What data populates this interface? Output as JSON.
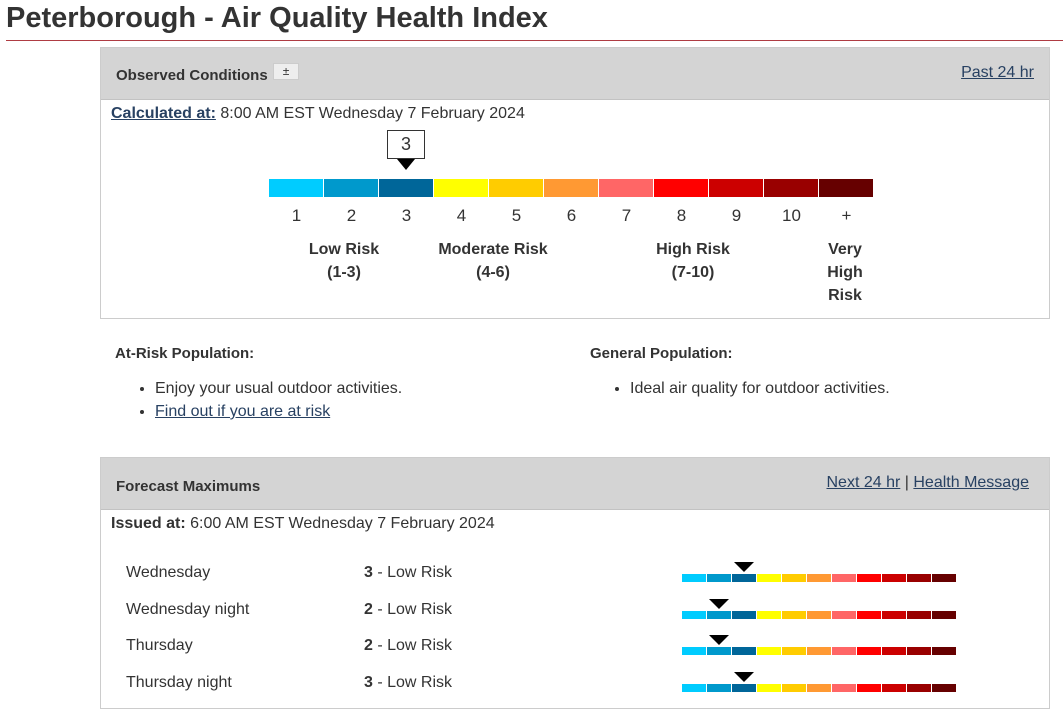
{
  "page": {
    "title": "Peterborough - Air Quality Health Index"
  },
  "observed": {
    "heading": "Observed Conditions",
    "toggle_symbol": "±",
    "past_link": "Past 24 hr",
    "calculated_label": "Calculated at:",
    "calculated_value": " 8:00 AM EST Wednesday 7 February 2024",
    "current_value": "3",
    "scale_labels": [
      "1",
      "2",
      "3",
      "4",
      "5",
      "6",
      "7",
      "8",
      "9",
      "10",
      "+"
    ],
    "scale_colors": [
      "#00ccff",
      "#0099cc",
      "#006699",
      "#ffff00",
      "#ffcc00",
      "#ff9933",
      "#ff6666",
      "#ff0000",
      "#cc0000",
      "#990000",
      "#660000"
    ],
    "risk_levels": [
      {
        "line1": "Low Risk",
        "line2": "(1-3)"
      },
      {
        "line1": "Moderate Risk",
        "line2": "(4-6)"
      },
      {
        "line1": "High Risk",
        "line2": "(7-10)"
      },
      {
        "line1": "Very",
        "line2": "High",
        "line3": "Risk"
      }
    ]
  },
  "at_risk": {
    "heading": "At-Risk Population:",
    "item1": "Enjoy your usual outdoor activities.",
    "item2_link": "Find out if you are at risk"
  },
  "general": {
    "heading": "General Population:",
    "item1": "Ideal air quality for outdoor activities."
  },
  "forecast": {
    "heading": "Forecast Maximums",
    "next_link": "Next 24 hr",
    "separator": "|",
    "health_link": "Health Message",
    "issued_label": "Issued at:",
    "issued_value": " 6:00 AM EST Wednesday 7 February 2024",
    "rows": [
      {
        "day": "Wednesday",
        "value": "3",
        "risk": " - Low Risk",
        "level": 3
      },
      {
        "day": "Wednesday night",
        "value": "2",
        "risk": " - Low Risk",
        "level": 2
      },
      {
        "day": "Thursday",
        "value": "2",
        "risk": " - Low Risk",
        "level": 2
      },
      {
        "day": "Thursday night",
        "value": "3",
        "risk": " - Low Risk",
        "level": 3
      }
    ]
  }
}
